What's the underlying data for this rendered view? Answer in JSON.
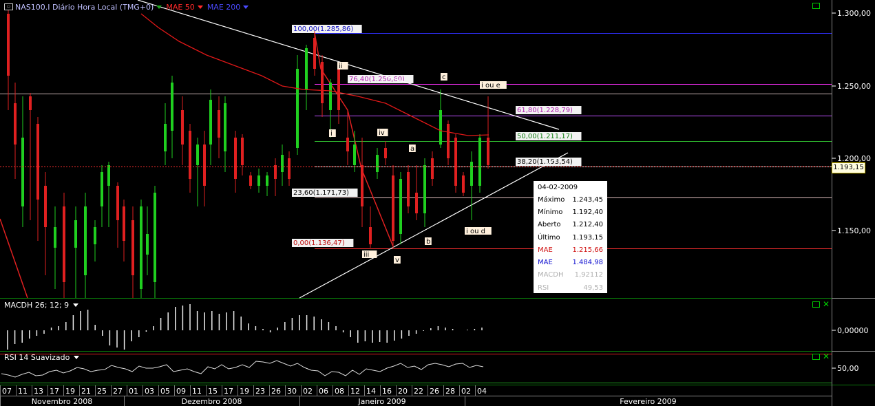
{
  "header": {
    "symbol_icon": "chart-icon",
    "instrument": "NAS100.I Diário Hora Local (TMG+0)",
    "mae50_label": "MAE 50",
    "mae200_label": "MAE 200",
    "mae50_color": "#ff2a2a",
    "mae200_color": "#2a2aff"
  },
  "price_axis": {
    "ticks": [
      "1.300,00",
      "1.250,00",
      "1.200,00",
      "1.150,00"
    ],
    "current_price": "1.193,15"
  },
  "fib_levels": [
    {
      "label": "100,00(1.285,86)",
      "color": "#3030ff"
    },
    {
      "label": "76,40(1.250,60)",
      "color": "#ff30ff"
    },
    {
      "label": "61,80(1.228,79)",
      "color": "#c050ff"
    },
    {
      "label": "50,00(1.211,17)",
      "color": "#30c030"
    },
    {
      "label": "38,20(1.193,54)",
      "color": "#ffffff"
    },
    {
      "label": "23,60(1.171,73)",
      "color": "#e0c0c0"
    },
    {
      "label": "0,00(1.136,47)",
      "color": "#ff3030"
    }
  ],
  "wave_labels": [
    "ii",
    "i",
    "iii",
    "iv",
    "v",
    "a",
    "b",
    "c",
    "i ou d",
    "i ou e"
  ],
  "info_box": {
    "date": "04-02-2009",
    "rows": [
      {
        "label": "Máximo",
        "value": "1.243,45",
        "color": "#000000"
      },
      {
        "label": "Mínimo",
        "value": "1.192,40",
        "color": "#000000"
      },
      {
        "label": "Aberto",
        "value": "1.212,40",
        "color": "#000000"
      },
      {
        "label": "Último",
        "value": "1.193,15",
        "color": "#000000"
      },
      {
        "label": "MAE",
        "value": "1.215,66",
        "color": "#d01010"
      },
      {
        "label": "MAE",
        "value": "1.484,98",
        "color": "#1010d0"
      },
      {
        "label": "MACDH",
        "value": "1,92112",
        "color": "#b0b0b0"
      },
      {
        "label": "RSI",
        "value": "49,53",
        "color": "#b0b0b0"
      }
    ]
  },
  "macd_panel": {
    "label": "MACDH 26; 12; 9",
    "tick": "0,00000"
  },
  "rsi_panel": {
    "label": "RSI 14 Suavizado",
    "tick": "50,00"
  },
  "date_axis": {
    "days": [
      "07",
      "11",
      "13",
      "17",
      "19",
      "21",
      "25",
      "27",
      "01",
      "03",
      "05",
      "09",
      "11",
      "15",
      "17",
      "19",
      "23",
      "26",
      "30",
      "02",
      "06",
      "08",
      "12",
      "14",
      "16",
      "20",
      "22",
      "26",
      "28",
      "02",
      "04"
    ],
    "months": [
      "Novembro 2008",
      "Dezembro 2008",
      "Janeiro 2009",
      "Fevereiro 2009"
    ]
  },
  "colors": {
    "up": "#20d020",
    "down": "#e02020",
    "ma50": "#e01818",
    "ma200": "#2020ff"
  }
}
